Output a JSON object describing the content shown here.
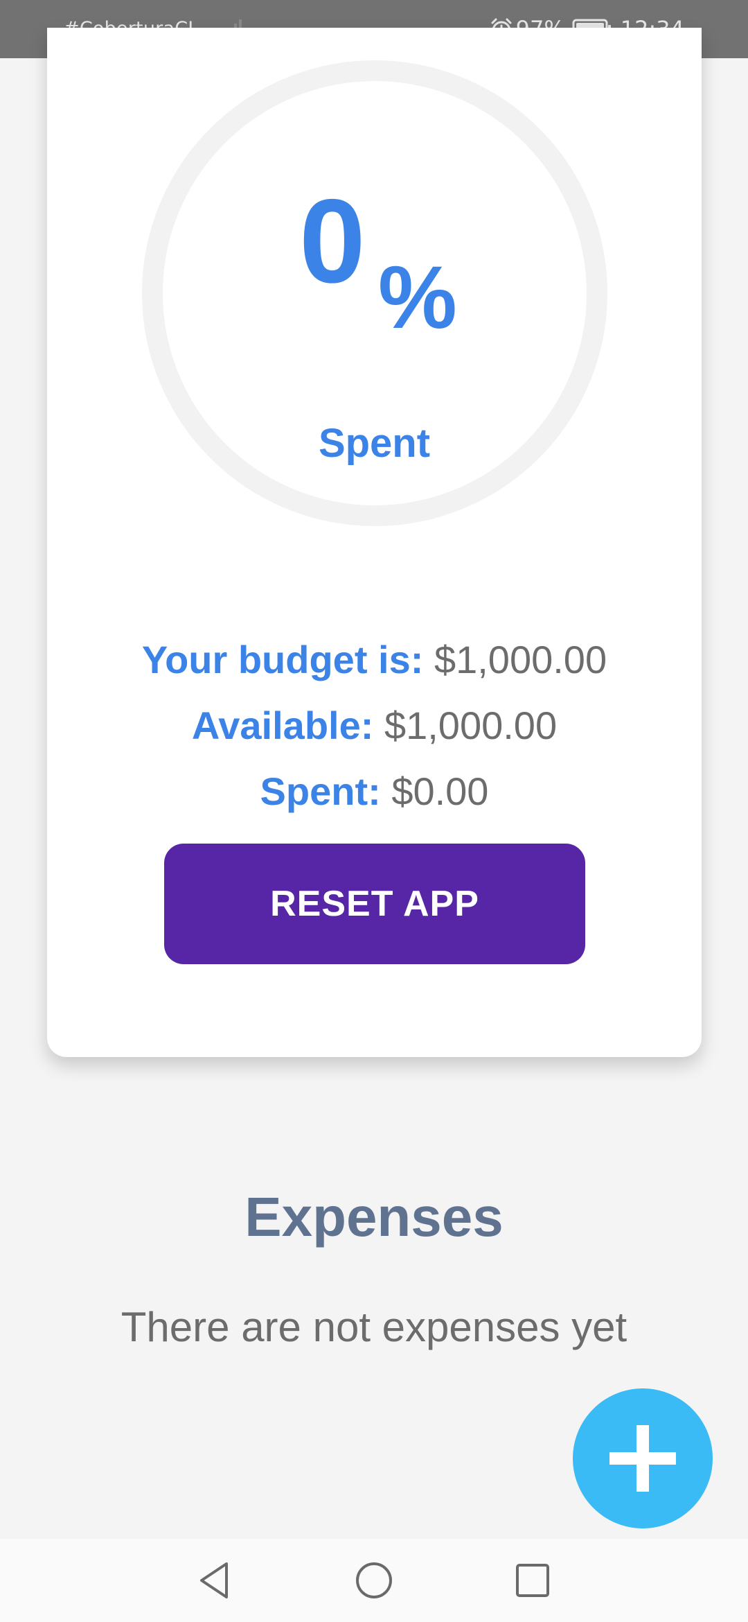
{
  "status_bar": {
    "carrier": "#CoberturaCL...",
    "battery": "97%",
    "time": "12:34",
    "icons": [
      "signal-icon",
      "alarm-icon",
      "battery-icon"
    ]
  },
  "budget_card": {
    "percent": {
      "value": "0",
      "sign": "%",
      "progress": 0
    },
    "spent_caption": "Spent",
    "lines": [
      {
        "label": "Your budget is:",
        "value": "$1,000.00"
      },
      {
        "label": "Available:",
        "value": "$1,000.00"
      },
      {
        "label": "Spent:",
        "value": "$0.00"
      }
    ],
    "reset_label": "RESET APP"
  },
  "expenses": {
    "title": "Expenses",
    "empty_message": "There are not expenses yet"
  },
  "fab": {
    "icon": "plus-icon"
  },
  "nav_bar": {
    "buttons": [
      "back-icon",
      "home-icon",
      "recents-icon"
    ]
  },
  "colors": {
    "accent_blue": "#3b83e6",
    "button_purple": "#5726a6",
    "fab_cyan": "#3bbbf5",
    "title_slate": "#5f7390",
    "text_gray": "#6c6c6c",
    "status_bar": "#727272",
    "background": "#f4f4f4"
  }
}
